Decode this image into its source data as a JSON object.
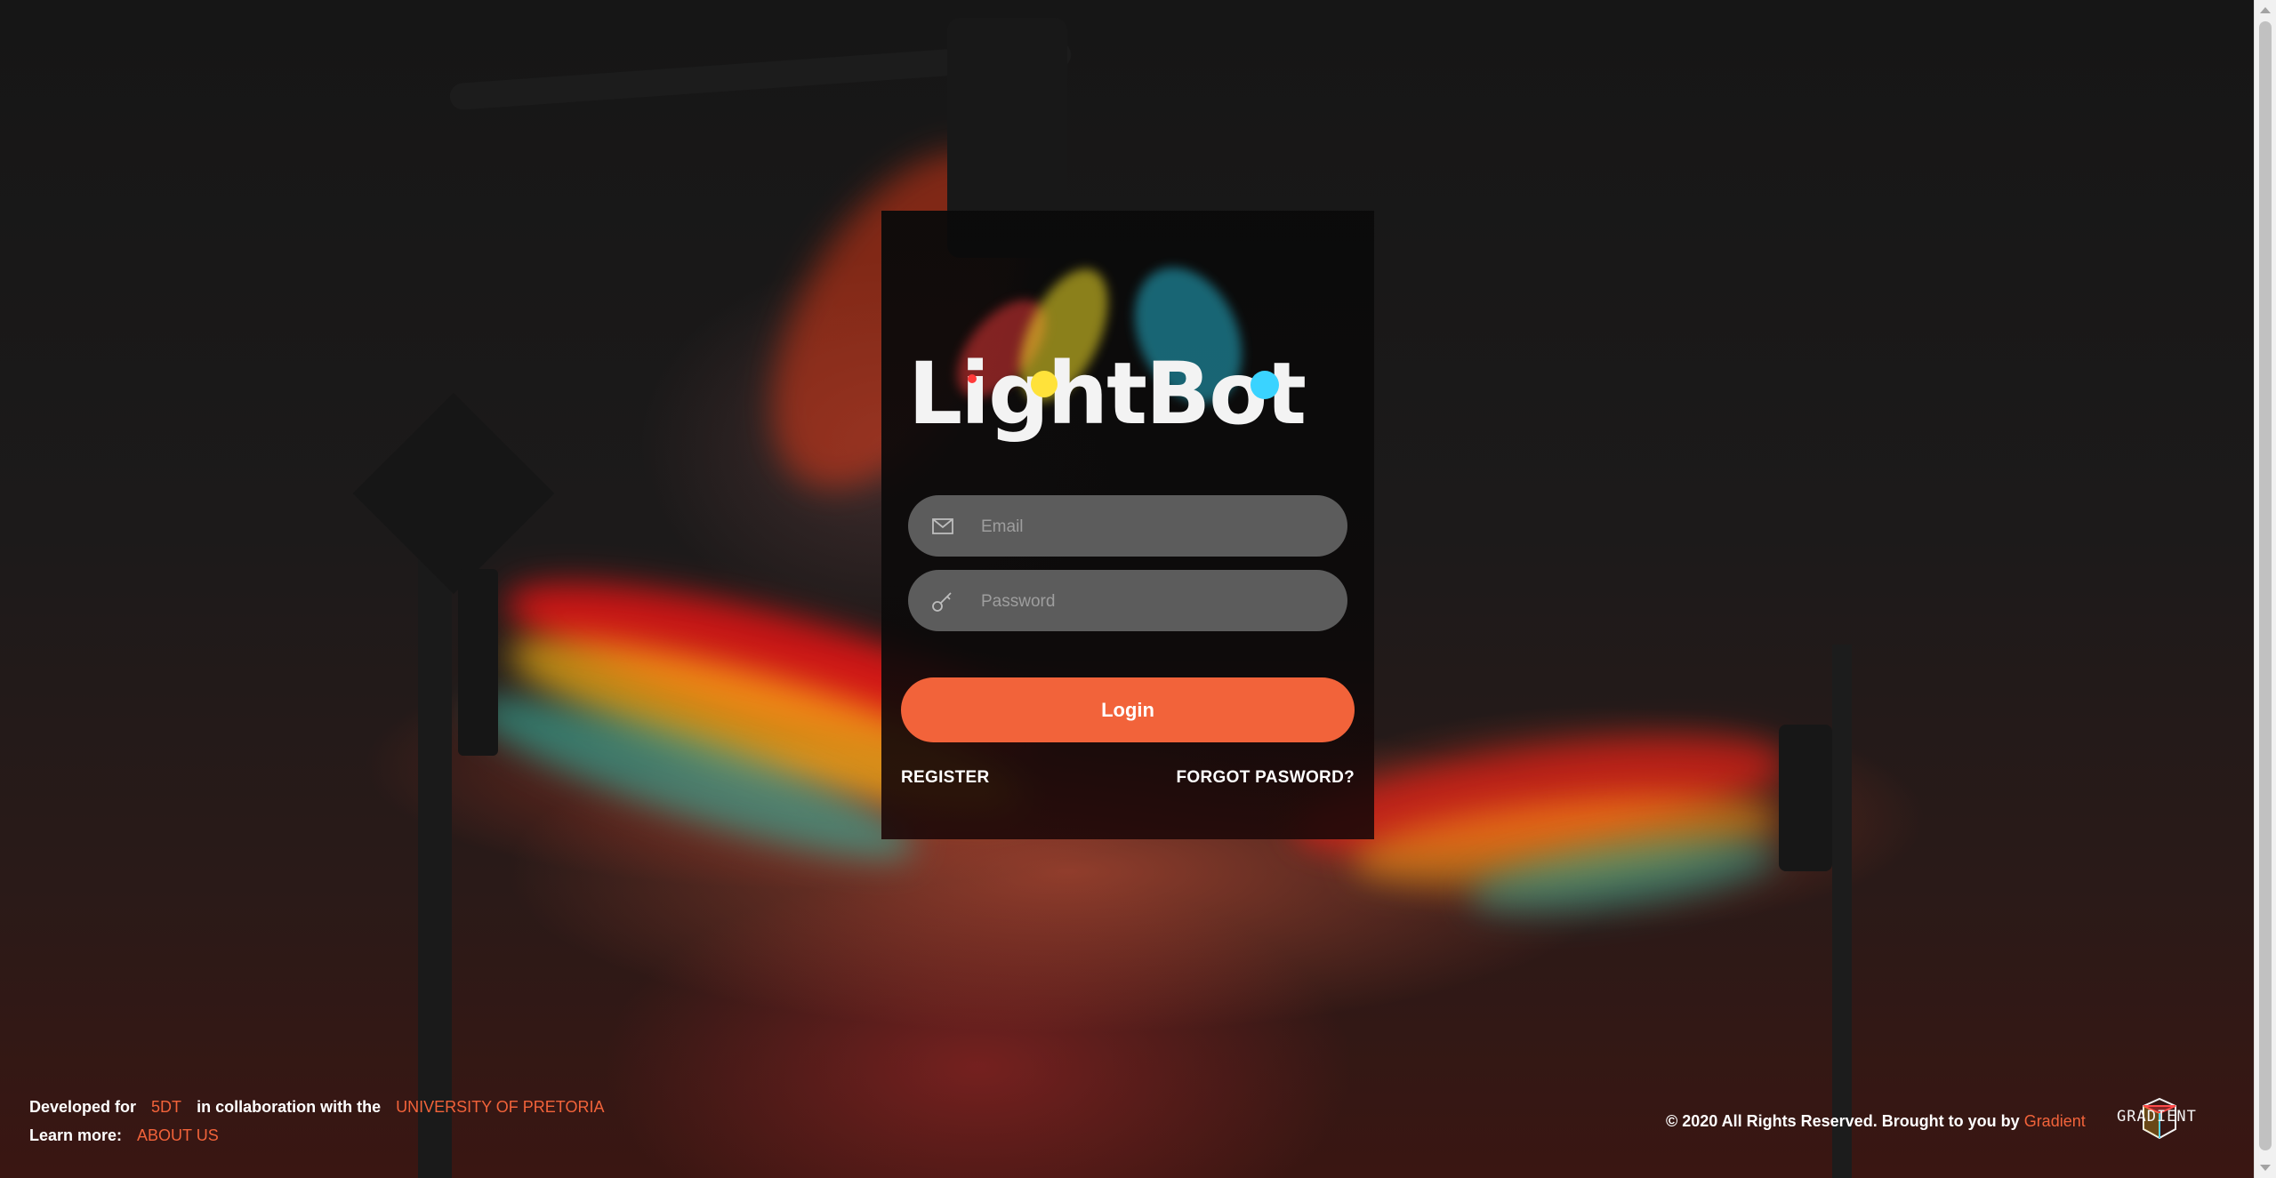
{
  "login": {
    "brand": "LightBot",
    "email_placeholder": "Email",
    "password_placeholder": "Password",
    "login_label": "Login",
    "register_label": "REGISTER",
    "forgot_label": "FORGOT PASWORD?"
  },
  "footer": {
    "developed_for": "Developed for",
    "client": "5DT",
    "collab": "in collaboration with the",
    "university": "UNIVERSITY OF PRETORIA",
    "learn_more": "Learn more:",
    "about": "ABOUT US",
    "copyright": "© 2020 All Rights Reserved. Brought to you by",
    "company": "Gradient",
    "badge_text": "GRADIENT"
  },
  "colors": {
    "accent": "#f2633a",
    "field": "#5c5c5c",
    "card": "#0c0c0c"
  },
  "icons": {
    "email": "envelope-icon",
    "password": "key-icon"
  }
}
